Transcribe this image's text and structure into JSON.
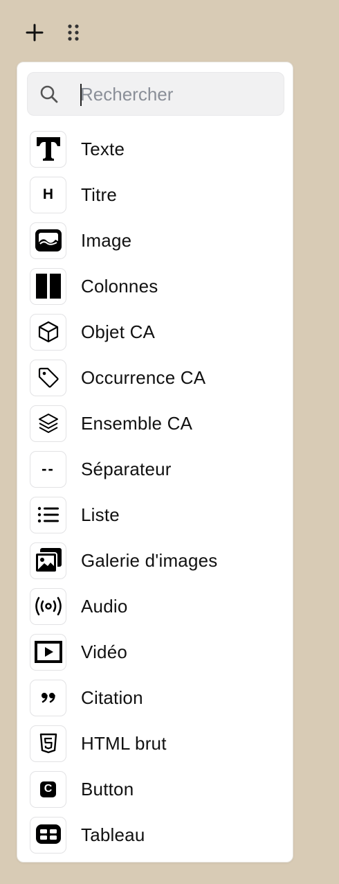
{
  "toolbar": {
    "add_label": "+",
    "drag_label": "⋮⋮"
  },
  "search": {
    "placeholder": "Rechercher",
    "value": ""
  },
  "items": [
    {
      "label": "Texte",
      "icon": "text-T-icon"
    },
    {
      "label": "Titre",
      "icon": "heading-icon",
      "glyph": "H"
    },
    {
      "label": "Image",
      "icon": "image-icon"
    },
    {
      "label": "Colonnes",
      "icon": "columns-icon"
    },
    {
      "label": "Objet CA",
      "icon": "cube-icon"
    },
    {
      "label": "Occurrence CA",
      "icon": "tag-icon"
    },
    {
      "label": "Ensemble CA",
      "icon": "layers-icon"
    },
    {
      "label": "Séparateur",
      "icon": "separator-icon",
      "glyph": "--"
    },
    {
      "label": "Liste",
      "icon": "list-icon"
    },
    {
      "label": "Galerie d'images",
      "icon": "gallery-icon"
    },
    {
      "label": "Audio",
      "icon": "audio-broadcast-icon"
    },
    {
      "label": "Vidéo",
      "icon": "video-play-icon"
    },
    {
      "label": "Citation",
      "icon": "quote-icon",
      "glyph": "”"
    },
    {
      "label": "HTML brut",
      "icon": "html5-icon"
    },
    {
      "label": "Button",
      "icon": "button-icon",
      "glyph": "C"
    },
    {
      "label": "Tableau",
      "icon": "table-icon"
    }
  ]
}
